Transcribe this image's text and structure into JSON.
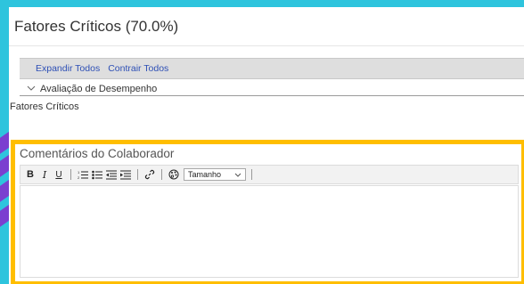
{
  "section": {
    "title": "Fatores Críticos (70.0%)"
  },
  "actions": {
    "expand_all": "Expandir Todos",
    "collapse_all": "Contrair Todos"
  },
  "group": {
    "label": "Avaliação de Desempenho",
    "sub_label": "Fatores Críticos"
  },
  "comments": {
    "title": "Comentários do Colaborador",
    "font_size": {
      "selected": "Tamanho"
    },
    "value": ""
  },
  "colors": {
    "background": "#2ec4dd",
    "highlight_frame": "#ffbe00",
    "link": "#2d4fb5"
  },
  "icons": [
    "bold-icon",
    "italic-icon",
    "underline-icon",
    "numbered-list-icon",
    "bulleted-list-icon",
    "outdent-icon",
    "indent-icon",
    "link-icon",
    "palette-icon",
    "chevron-down-icon"
  ]
}
